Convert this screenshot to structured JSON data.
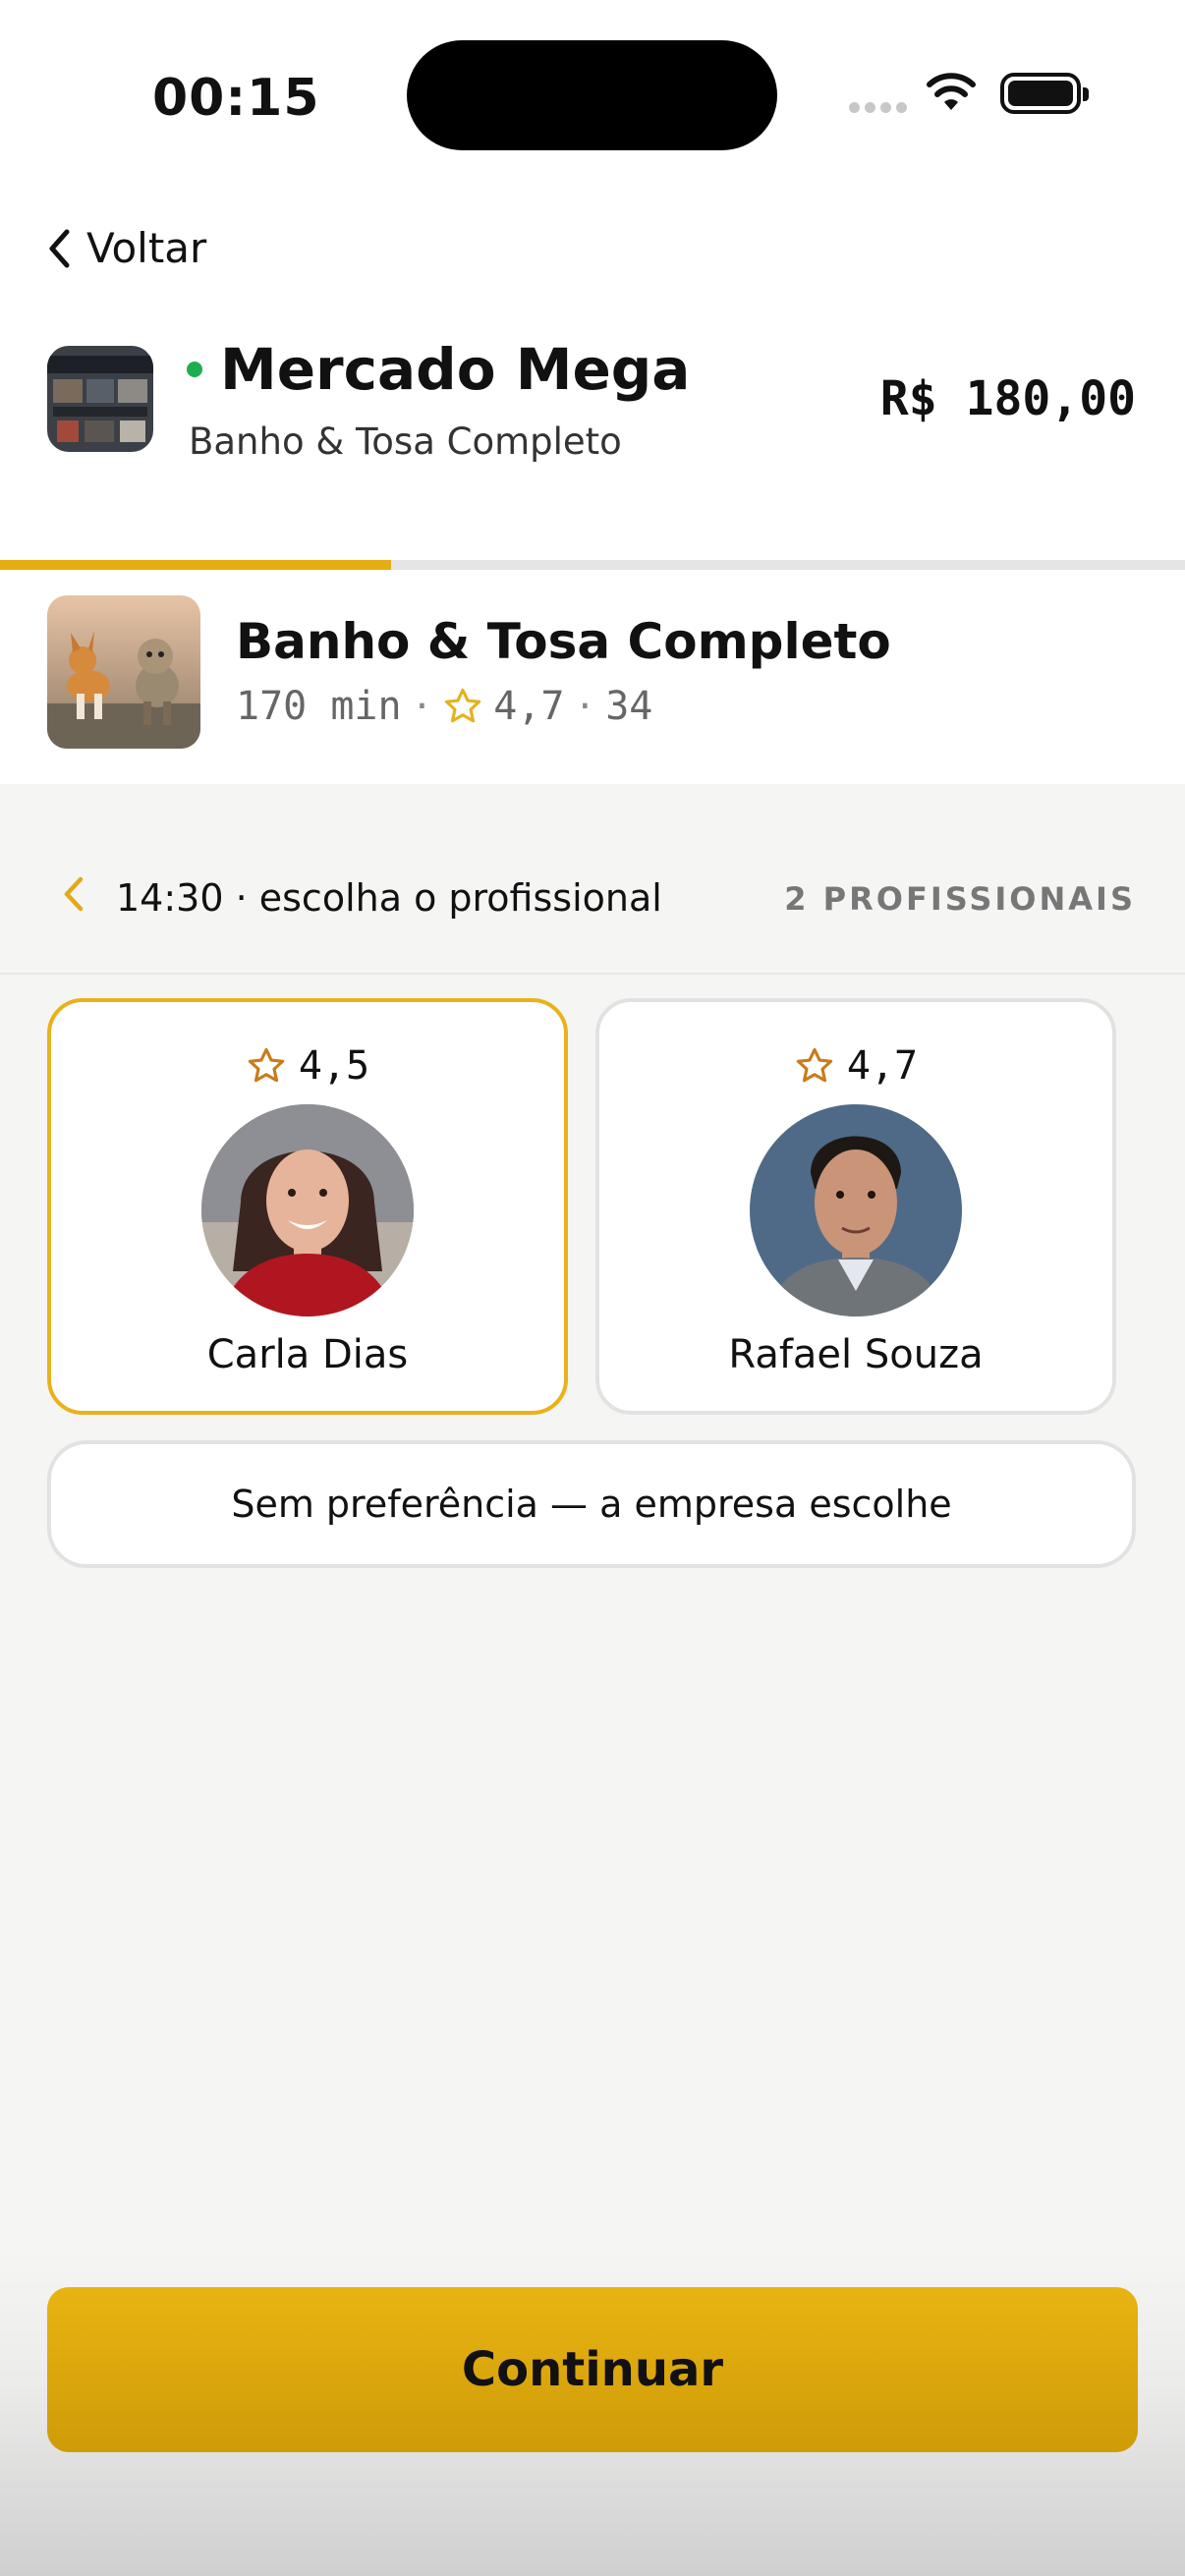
{
  "status_bar": {
    "time": "00:15"
  },
  "header": {
    "back_label": "Voltar",
    "store_name": "Mercado Mega",
    "store_subtitle": "Banho & Tosa Completo",
    "price": "R$ 180,00",
    "online_color": "#1fae4f"
  },
  "progress": {
    "fraction": 0.33
  },
  "service": {
    "title": "Banho & Tosa Completo",
    "duration": "170 min",
    "rating": "4,7",
    "reviews": "34"
  },
  "section": {
    "title": "14:30 · escolha o profissional",
    "count": "2 PROFISSIONAIS"
  },
  "professionals": [
    {
      "name": "Carla Dias",
      "rating": "4,5",
      "selected": true
    },
    {
      "name": "Rafael Souza",
      "rating": "4,7",
      "selected": false
    }
  ],
  "no_preference_label": "Sem preferência — a empresa escolhe",
  "continue_label": "Continuar",
  "colors": {
    "accent": "#e9b21b",
    "button": "#e0a90f"
  }
}
